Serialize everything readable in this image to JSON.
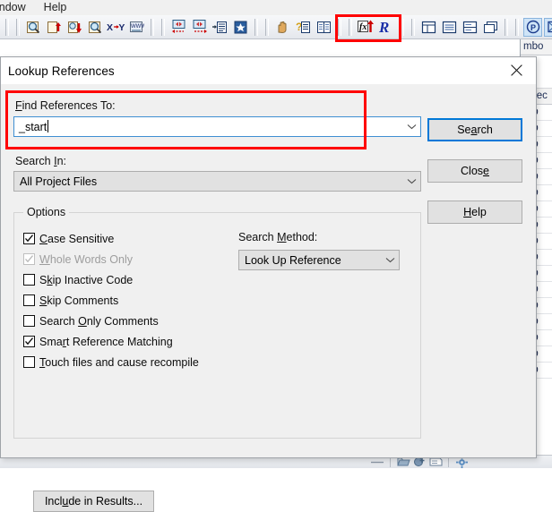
{
  "menu": {
    "items": [
      {
        "label": "indow",
        "name": "menu-window"
      },
      {
        "label": "Help",
        "name": "menu-help"
      }
    ]
  },
  "toolbar": {
    "groups": [
      {
        "buttons": [
          {
            "name": "search-magnifier-icon",
            "icon": "magnifier"
          },
          {
            "name": "search-up-icon",
            "icon": "magnifier-up"
          },
          {
            "name": "search-down-icon",
            "icon": "magnifier-down"
          },
          {
            "name": "search-all-icon",
            "icon": "magnifier-plain"
          },
          {
            "name": "xy-convert-icon",
            "icon": "x-to-y",
            "label": "X→Y"
          },
          {
            "name": "web-lookup-icon",
            "icon": "www"
          }
        ]
      },
      {
        "buttons": [
          {
            "name": "jump-back-icon",
            "icon": "nav-back"
          },
          {
            "name": "jump-forward-icon",
            "icon": "nav-forward"
          },
          {
            "name": "goto-line-icon",
            "icon": "goto-line"
          },
          {
            "name": "bookmark-icon",
            "icon": "star"
          }
        ]
      },
      {
        "buttons": [
          {
            "name": "hand-tool-icon",
            "icon": "hand"
          },
          {
            "name": "context-help-icon",
            "icon": "question-page"
          },
          {
            "name": "documentation-icon",
            "icon": "book"
          }
        ]
      },
      {
        "buttons": [
          {
            "name": "function-lookup-icon",
            "icon": "fx-arrow",
            "label": "fx"
          },
          {
            "name": "lookup-references-icon",
            "icon": "script-r",
            "label": "R"
          }
        ]
      },
      {
        "buttons": [
          {
            "name": "panel-grid-icon",
            "icon": "panel-grid"
          },
          {
            "name": "panel-list-icon",
            "icon": "panel-list"
          },
          {
            "name": "panel-split-icon",
            "icon": "panel-split"
          },
          {
            "name": "panel-cascade-icon",
            "icon": "panel-cascade"
          }
        ]
      },
      {
        "buttons": [
          {
            "name": "project-icon",
            "icon": "circle-p",
            "label": "P",
            "active": true
          },
          {
            "name": "resize-icon",
            "icon": "bracket-frame",
            "active": true
          },
          {
            "name": "add-panel-icon",
            "icon": "plus-panel"
          }
        ]
      }
    ]
  },
  "background_panel": {
    "column_header": "mbo",
    "second_header": "Direc",
    "rows": [
      "u-b",
      "u-b",
      "u-b",
      "u-b",
      "u-b",
      "u-b",
      "u-b",
      "u-b",
      "u-b",
      "u-b",
      "u-b",
      "u-b",
      "u-b",
      "u-b",
      "u-b",
      "u-b",
      "u-b"
    ]
  },
  "dialog": {
    "title": "Lookup References",
    "close_icon": "close-icon",
    "find": {
      "label": "Find References To:",
      "label_prefix": "F",
      "label_rest": "ind References To:",
      "value": "_start",
      "placeholder": ""
    },
    "search_in": {
      "label_prefix": "Search ",
      "label_underlined": "I",
      "label_suffix": "n:",
      "value": "All Project Files",
      "options": [
        "All Project Files"
      ]
    },
    "buttons": {
      "search": {
        "prefix": "Se",
        "underlined": "a",
        "suffix": "rch",
        "full": "Search"
      },
      "close": {
        "prefix": "Clos",
        "underlined": "e",
        "suffix": "",
        "full": "Close"
      },
      "help": {
        "prefix": "",
        "underlined": "H",
        "suffix": "elp",
        "full": "Help"
      },
      "include": {
        "prefix": "Incl",
        "underlined": "u",
        "suffix": "de in Results...",
        "full": "Include in Results..."
      }
    },
    "options": {
      "group_title": "Options",
      "checkboxes": [
        {
          "name": "checkbox-case-sensitive",
          "prefix": "",
          "underlined": "C",
          "suffix": "ase Sensitive",
          "full": "Case Sensitive",
          "checked": true,
          "disabled": false
        },
        {
          "name": "checkbox-whole-words-only",
          "prefix": "",
          "underlined": "W",
          "suffix": "hole Words Only",
          "full": "Whole Words Only",
          "checked": true,
          "disabled": true
        },
        {
          "name": "checkbox-skip-inactive-code",
          "prefix": "S",
          "underlined": "k",
          "suffix": "ip Inactive Code",
          "full": "Skip Inactive Code",
          "checked": false,
          "disabled": false
        },
        {
          "name": "checkbox-skip-comments",
          "prefix": "",
          "underlined": "S",
          "suffix": "kip Comments",
          "full": "Skip Comments",
          "checked": false,
          "disabled": false
        },
        {
          "name": "checkbox-search-only-comments",
          "prefix": "Search ",
          "underlined": "O",
          "suffix": "nly Comments",
          "full": "Search Only Comments",
          "checked": false,
          "disabled": false
        },
        {
          "name": "checkbox-smart-reference-matching",
          "prefix": "Sma",
          "underlined": "r",
          "suffix": "t Reference Matching",
          "full": "Smart Reference Matching",
          "checked": true,
          "disabled": false
        },
        {
          "name": "checkbox-touch-files",
          "prefix": "",
          "underlined": "T",
          "suffix": "ouch files and cause recompile",
          "full": "Touch files and cause recompile",
          "checked": false,
          "disabled": false
        }
      ],
      "search_method": {
        "label_prefix": "Search ",
        "label_underlined": "M",
        "label_suffix": "ethod:",
        "value": "Look Up Reference",
        "options": [
          "Look Up Reference"
        ]
      }
    }
  },
  "annotations": {
    "toolbar_highlight_color": "#ff0000",
    "field_highlight_color": "#ff0000"
  },
  "colors": {
    "accent": "#0078d7",
    "dialog_bg": "#f0f0f0",
    "button_bg": "#e1e1e1",
    "highlight_red": "#ff0000"
  }
}
